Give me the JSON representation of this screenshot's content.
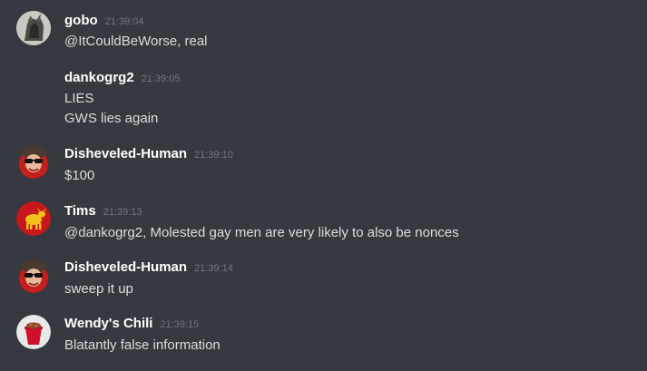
{
  "messages": [
    {
      "username": "gobo",
      "timestamp": "21:39:04",
      "lines": [
        "@ItCouldBeWorse, real"
      ],
      "avatar": "gobo-avatar"
    },
    {
      "username": "dankogrg2",
      "timestamp": "21:39:05",
      "lines": [
        "LIES",
        "GWS lies again"
      ],
      "avatar": null
    },
    {
      "username": "Disheveled-Human",
      "timestamp": "21:39:10",
      "lines": [
        "$100"
      ],
      "avatar": "disheveled-human-avatar"
    },
    {
      "username": "Tims",
      "timestamp": "21:39:13",
      "lines": [
        "@dankogrg2, Molested gay men are very likely to also be nonces"
      ],
      "avatar": "tims-avatar"
    },
    {
      "username": "Disheveled-Human",
      "timestamp": "21:39:14",
      "lines": [
        "sweep it up"
      ],
      "avatar": "disheveled-human-avatar"
    },
    {
      "username": "Wendy's Chili",
      "timestamp": "21:39:15",
      "lines": [
        "Blatantly false information"
      ],
      "avatar": "wendys-chili-avatar"
    }
  ],
  "colors": {
    "background": "#36393f",
    "username": "#ffffff",
    "timestamp": "#72767d",
    "text": "#dcddde",
    "tims_avatar_bg": "#c8161d",
    "tims_cow": "#f2c21b"
  }
}
